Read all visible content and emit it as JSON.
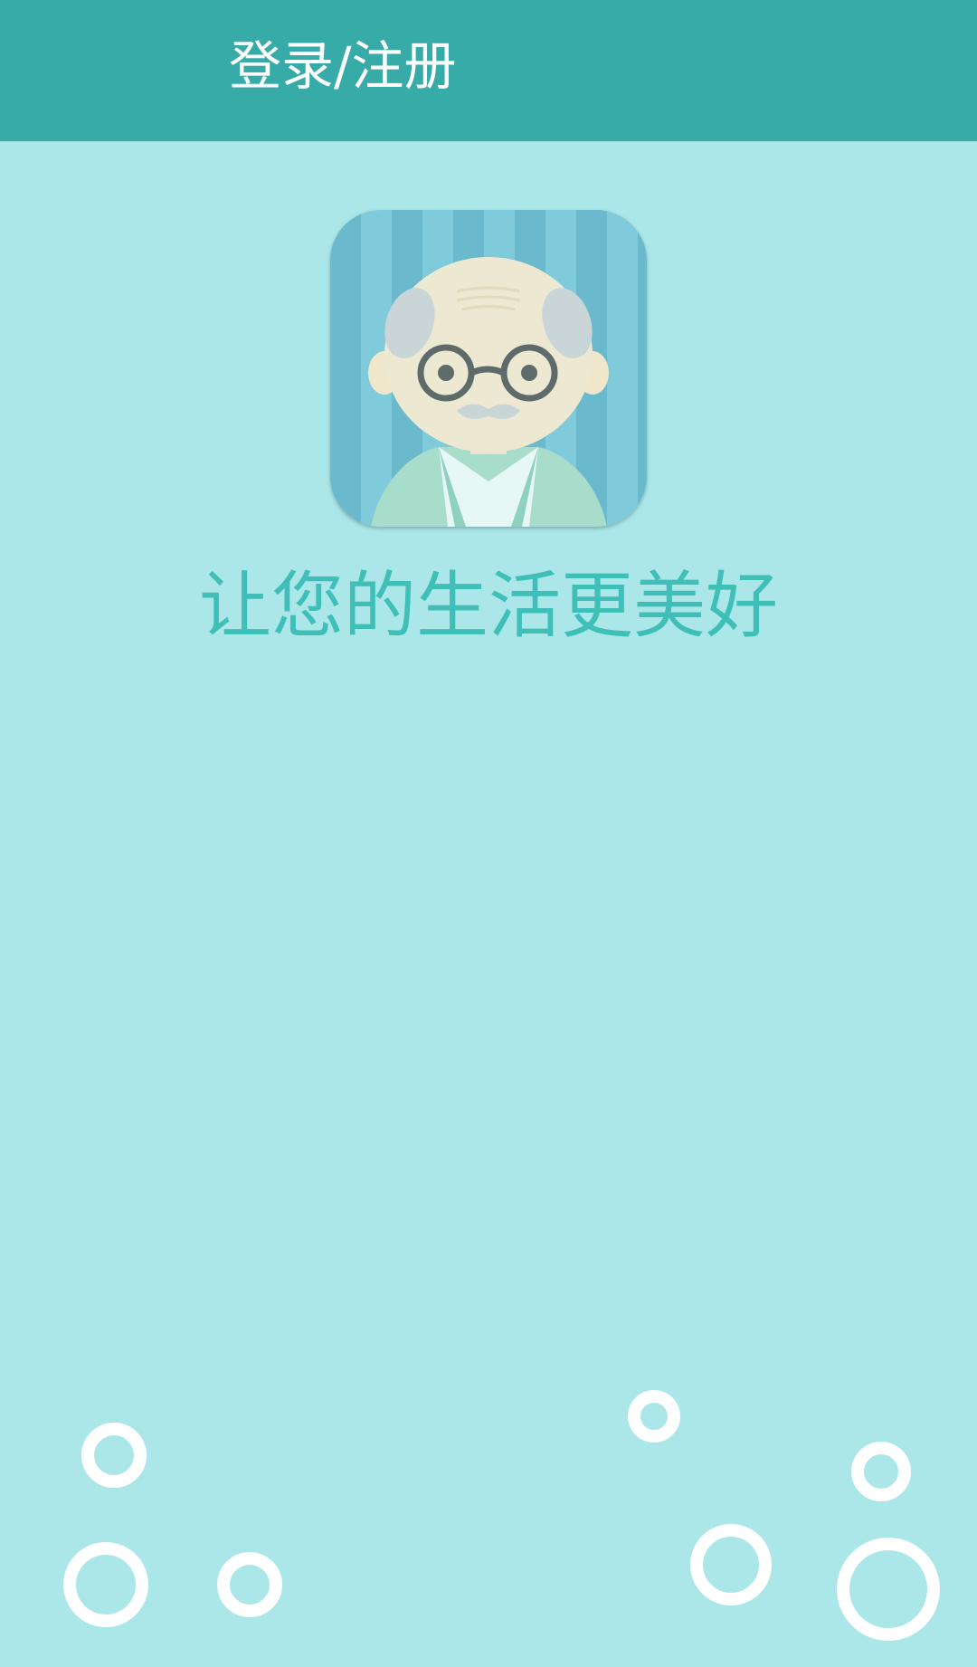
{
  "header": {
    "title": "登录/注册"
  },
  "main": {
    "avatar_icon": "elderly-man-avatar-icon",
    "slogan": "让您的生活更美好"
  },
  "decoration": {
    "icon": "bubble-ring-icon"
  },
  "colors": {
    "header_bg": "#37aba7",
    "page_bg": "#abe7e8",
    "slogan": "#3fbfb8",
    "bubble": "#ffffff"
  }
}
